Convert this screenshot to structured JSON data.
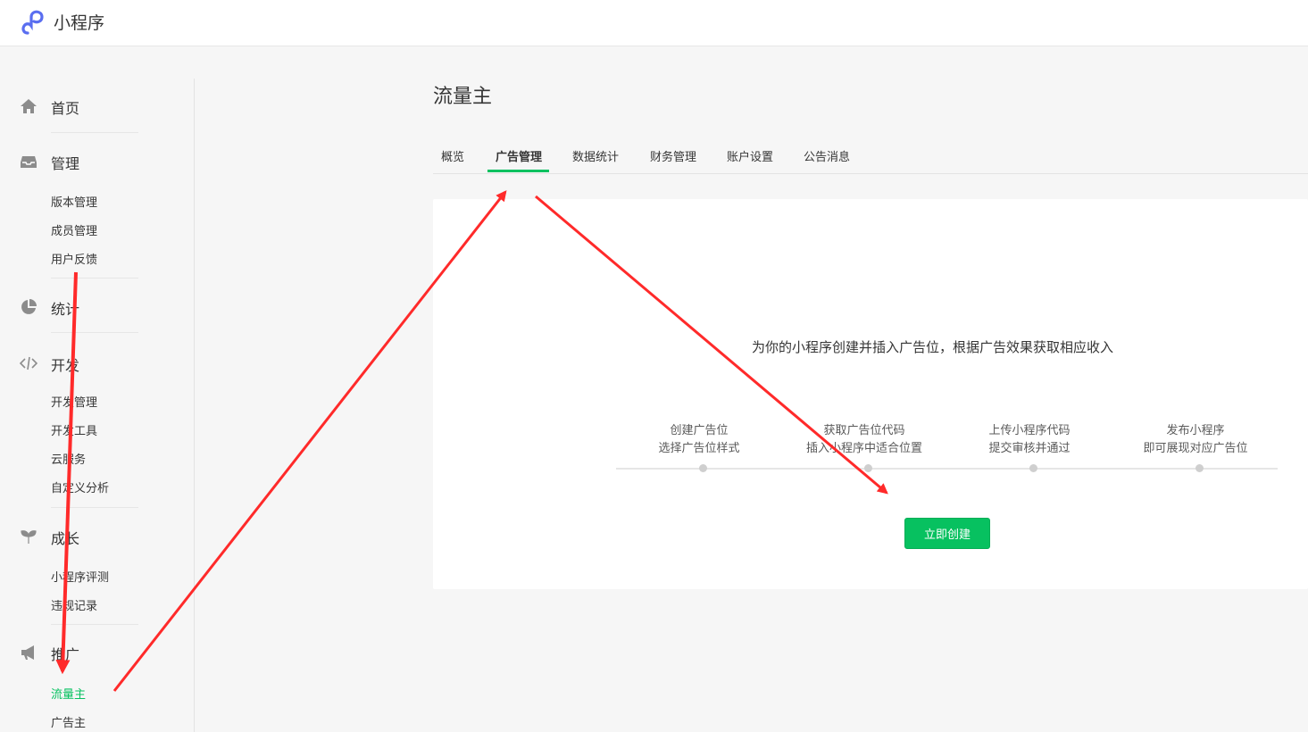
{
  "app": {
    "title": "小程序"
  },
  "sidebar": {
    "home": {
      "label": "首页"
    },
    "manage": {
      "label": "管理",
      "items": [
        "版本管理",
        "成员管理",
        "用户反馈"
      ]
    },
    "stats": {
      "label": "统计"
    },
    "develop": {
      "label": "开发",
      "items": [
        "开发管理",
        "开发工具",
        "云服务",
        "自定义分析"
      ]
    },
    "growth": {
      "label": "成长",
      "items": [
        "小程序评测",
        "违规记录"
      ]
    },
    "promote": {
      "label": "推广",
      "items": [
        "流量主",
        "广告主"
      ],
      "active": "流量主"
    }
  },
  "main": {
    "title": "流量主",
    "tabs": [
      "概览",
      "广告管理",
      "数据统计",
      "财务管理",
      "账户设置",
      "公告消息"
    ],
    "active_tab": "广告管理",
    "intro": "为你的小程序创建并插入广告位，根据广告效果获取相应收入",
    "steps": [
      {
        "title": "创建广告位",
        "desc": "选择广告位样式"
      },
      {
        "title": "获取广告位代码",
        "desc": "插入小程序中适合位置"
      },
      {
        "title": "上传小程序代码",
        "desc": "提交审核并通过"
      },
      {
        "title": "发布小程序",
        "desc": "即可展现对应广告位"
      }
    ],
    "create_button": "立即创建"
  },
  "colors": {
    "accent": "#07c160",
    "annotation": "#ff2a2a",
    "logo": "#5a6ef0"
  }
}
